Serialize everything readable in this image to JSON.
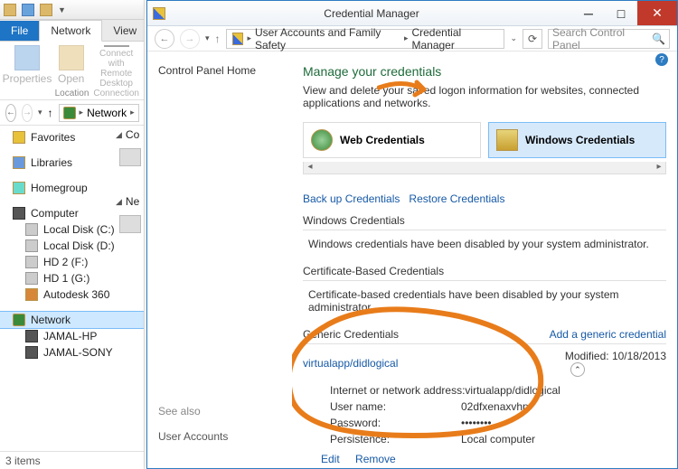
{
  "explorer": {
    "tabs": {
      "file": "File",
      "network": "Network",
      "view": "View"
    },
    "ribbon": {
      "properties": "Properties",
      "open": "Open",
      "connect": "Connect with Remote\nDesktop Connection",
      "group": "Location"
    },
    "addr_prefix": "Network",
    "tree": {
      "favorites": "Favorites",
      "libraries": "Libraries",
      "homegroup": "Homegroup",
      "computer": "Computer",
      "drives": [
        "Local Disk (C:)",
        "Local Disk (D:)",
        "HD 2 (F:)",
        "HD 1 (G:)",
        "Autodesk 360"
      ],
      "network": "Network",
      "net_items": [
        "JAMAL-HP",
        "JAMAL-SONY"
      ]
    },
    "mid": {
      "computer_hd": "Co",
      "network_hd": "Ne"
    },
    "footer": "3 items"
  },
  "cm": {
    "title": "Credential Manager",
    "crumb1": "User Accounts and Family Safety",
    "crumb2": "Credential Manager",
    "search_ph": "Search Control Panel",
    "left_home": "Control Panel Home",
    "see_also": "See also",
    "user_accounts": "User Accounts",
    "heading": "Manage your credentials",
    "desc": "View and delete your saved logon information for websites, connected applications and networks.",
    "web_cred": "Web Credentials",
    "win_cred": "Windows Credentials",
    "backup": "Back up Credentials",
    "restore": "Restore Credentials",
    "sec_win": "Windows Credentials",
    "msg_win": "Windows credentials have been disabled by your system administrator.",
    "sec_cert": "Certificate-Based Credentials",
    "msg_cert": "Certificate-based credentials have been disabled by your system administrator.",
    "sec_generic": "Generic Credentials",
    "add_generic": "Add a generic credential",
    "entry_name": "virtualapp/didlogical",
    "modified_lbl": "Modified:",
    "modified_val": "10/18/2013",
    "k_addr": "Internet or network address:",
    "v_addr": "virtualapp/didlogical",
    "k_user": "User name:",
    "v_user": "02dfxenaxvhp",
    "k_pass": "Password:",
    "v_pass": "••••••••",
    "k_pers": "Persistence:",
    "v_pers": "Local computer",
    "edit": "Edit",
    "remove": "Remove"
  }
}
